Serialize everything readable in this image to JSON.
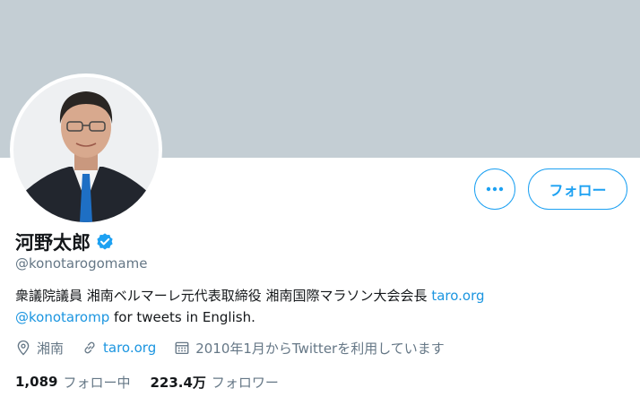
{
  "profile": {
    "display_name": "河野太郎",
    "handle": "@konotarogomame",
    "bio_text": "衆議院議員 湘南ベルマーレ元代表取締役 湘南国際マラソン大会会長",
    "bio_link1": "taro.org",
    "bio_link2": "@konotaromp",
    "bio_text2": "for tweets in English."
  },
  "actions": {
    "follow_label": "フォロー"
  },
  "meta": {
    "location": "湘南",
    "website": "taro.org",
    "joined": "2010年1月からTwitterを利用しています"
  },
  "stats": {
    "following_count": "1,089",
    "following_label": "フォロー中",
    "followers_count": "223.4万",
    "followers_label": "フォロワー"
  },
  "colors": {
    "accent": "#1da1f2",
    "banner": "#c4ced4",
    "verified": "#1da1f2",
    "secondary_text": "#657786"
  },
  "icons": {
    "more": "more-horizontal-icon",
    "verified": "verified-badge-icon",
    "location": "location-pin-icon",
    "link": "link-icon",
    "calendar": "calendar-icon"
  }
}
